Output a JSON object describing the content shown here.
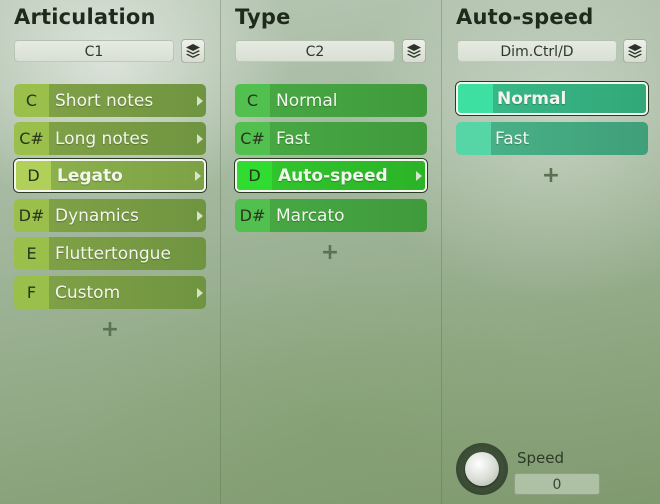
{
  "articulation": {
    "title": "Articulation",
    "slot": "C1",
    "add_label": "+",
    "items": [
      {
        "key": "C",
        "label": "Short notes"
      },
      {
        "key": "C#",
        "label": "Long notes"
      },
      {
        "key": "D",
        "label": "Legato"
      },
      {
        "key": "D#",
        "label": "Dynamics"
      },
      {
        "key": "E",
        "label": "Fluttertongue"
      },
      {
        "key": "F",
        "label": "Custom"
      }
    ]
  },
  "type": {
    "title": "Type",
    "slot": "C2",
    "add_label": "+",
    "items": [
      {
        "key": "C",
        "label": "Normal"
      },
      {
        "key": "C#",
        "label": "Fast"
      },
      {
        "key": "D",
        "label": "Auto-speed"
      },
      {
        "key": "D#",
        "label": "Marcato"
      }
    ]
  },
  "auto_speed": {
    "title": "Auto-speed",
    "slot": "Dim.Ctrl/D",
    "add_label": "+",
    "items": [
      {
        "key": "",
        "label": "Normal"
      },
      {
        "key": "",
        "label": "Fast"
      }
    ]
  },
  "speed_control": {
    "label": "Speed",
    "value": "0"
  },
  "colors": {
    "articulation_accent": "#9abf4a",
    "type_accent": "#52c04e",
    "auto_speed_accent": "#42cf98"
  }
}
